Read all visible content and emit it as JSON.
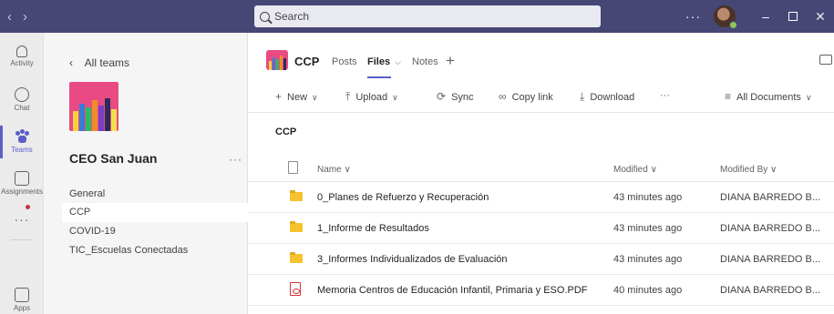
{
  "titlebar": {
    "search_placeholder": "Search",
    "more": "···"
  },
  "rail": {
    "items": [
      {
        "label": "Activity",
        "icon": "bell-icon"
      },
      {
        "label": "Chat",
        "icon": "chat-icon"
      },
      {
        "label": "Teams",
        "icon": "teams-icon",
        "active": true
      },
      {
        "label": "Assignments",
        "icon": "assignments-icon"
      },
      {
        "label": "Apps",
        "icon": "apps-icon"
      }
    ],
    "more": "···"
  },
  "team": {
    "back_label": "All teams",
    "name": "CEO San Juan",
    "more": "···",
    "channels": [
      "General",
      "CCP",
      "COVID-19",
      "TIC_Escuelas Conectadas"
    ],
    "selected_channel": "CCP"
  },
  "channel_header": {
    "title": "CCP",
    "tabs": [
      "Posts",
      "Files",
      "Notes"
    ],
    "active_tab": "Files",
    "files_caret": "⌵",
    "add": "+"
  },
  "toolbar": {
    "new": "New",
    "upload": "Upload",
    "sync": "Sync",
    "copy_link": "Copy link",
    "download": "Download",
    "more": "···",
    "view": "All Documents"
  },
  "breadcrumb": "CCP",
  "files_table": {
    "columns": [
      "Name",
      "Modified",
      "Modified By"
    ],
    "rows": [
      {
        "type": "folder",
        "name": "0_Planes de Refuerzo y Recuperación",
        "modified": "43 minutes ago",
        "modified_by": "DIANA BARREDO B..."
      },
      {
        "type": "folder",
        "name": "1_Informe de Resultados",
        "modified": "43 minutes ago",
        "modified_by": "DIANA BARREDO B..."
      },
      {
        "type": "folder",
        "name": "3_Informes Individualizados de Evaluación",
        "modified": "43 minutes ago",
        "modified_by": "DIANA BARREDO B..."
      },
      {
        "type": "pdf",
        "name": "Memoria Centros de Educación Infantil, Primaria y ESO.PDF",
        "modified": "40 minutes ago",
        "modified_by": "DIANA BARREDO B..."
      }
    ]
  },
  "colors": {
    "titlebar": "#464775",
    "accent": "#5b5fc7",
    "team_art": "#ea4a84",
    "folder": "#f4c32d",
    "pdf": "#d13438"
  }
}
